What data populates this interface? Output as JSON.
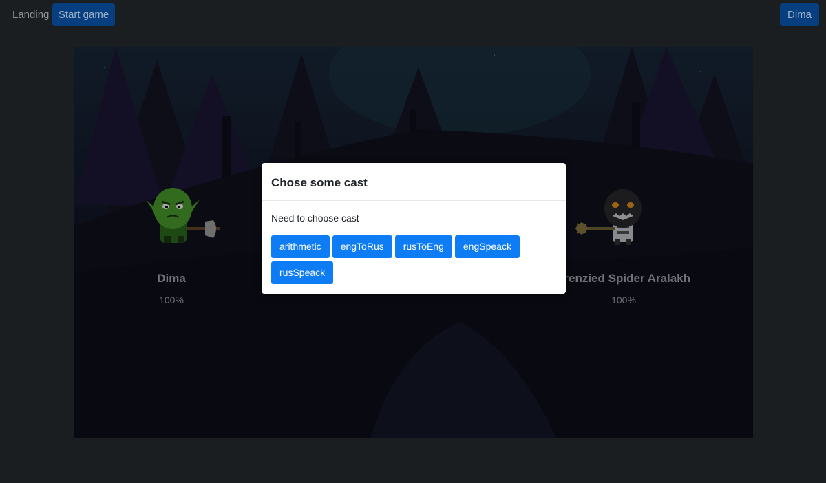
{
  "topbar": {
    "nav_label": "Landing",
    "start_label": "Start game",
    "user_label": "Dima"
  },
  "battle": {
    "hero": {
      "name": "Dima",
      "hp": "100%"
    },
    "enemy": {
      "name": "Frenzied Spider Aralakh",
      "hp": "100%"
    }
  },
  "modal": {
    "title": "Chose some cast",
    "text": "Need to choose cast",
    "casts": [
      "arithmetic",
      "engToRus",
      "rusToEng",
      "engSpeack",
      "rusSpeack"
    ]
  },
  "colors": {
    "page_bg": "#1b1e21",
    "primary": "#0d7cf5",
    "nav_button": "#063f80"
  }
}
